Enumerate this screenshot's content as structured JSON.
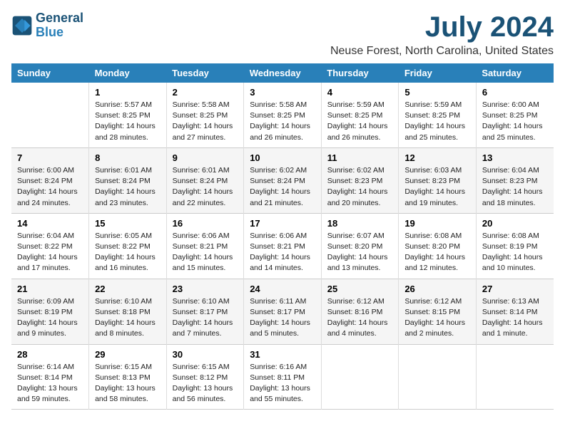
{
  "logo": {
    "line1": "General",
    "line2": "Blue"
  },
  "title": "July 2024",
  "subtitle": "Neuse Forest, North Carolina, United States",
  "days_of_week": [
    "Sunday",
    "Monday",
    "Tuesday",
    "Wednesday",
    "Thursday",
    "Friday",
    "Saturday"
  ],
  "weeks": [
    [
      {
        "day": "",
        "info": ""
      },
      {
        "day": "1",
        "info": "Sunrise: 5:57 AM\nSunset: 8:25 PM\nDaylight: 14 hours\nand 28 minutes."
      },
      {
        "day": "2",
        "info": "Sunrise: 5:58 AM\nSunset: 8:25 PM\nDaylight: 14 hours\nand 27 minutes."
      },
      {
        "day": "3",
        "info": "Sunrise: 5:58 AM\nSunset: 8:25 PM\nDaylight: 14 hours\nand 26 minutes."
      },
      {
        "day": "4",
        "info": "Sunrise: 5:59 AM\nSunset: 8:25 PM\nDaylight: 14 hours\nand 26 minutes."
      },
      {
        "day": "5",
        "info": "Sunrise: 5:59 AM\nSunset: 8:25 PM\nDaylight: 14 hours\nand 25 minutes."
      },
      {
        "day": "6",
        "info": "Sunrise: 6:00 AM\nSunset: 8:25 PM\nDaylight: 14 hours\nand 25 minutes."
      }
    ],
    [
      {
        "day": "7",
        "info": "Sunrise: 6:00 AM\nSunset: 8:24 PM\nDaylight: 14 hours\nand 24 minutes."
      },
      {
        "day": "8",
        "info": "Sunrise: 6:01 AM\nSunset: 8:24 PM\nDaylight: 14 hours\nand 23 minutes."
      },
      {
        "day": "9",
        "info": "Sunrise: 6:01 AM\nSunset: 8:24 PM\nDaylight: 14 hours\nand 22 minutes."
      },
      {
        "day": "10",
        "info": "Sunrise: 6:02 AM\nSunset: 8:24 PM\nDaylight: 14 hours\nand 21 minutes."
      },
      {
        "day": "11",
        "info": "Sunrise: 6:02 AM\nSunset: 8:23 PM\nDaylight: 14 hours\nand 20 minutes."
      },
      {
        "day": "12",
        "info": "Sunrise: 6:03 AM\nSunset: 8:23 PM\nDaylight: 14 hours\nand 19 minutes."
      },
      {
        "day": "13",
        "info": "Sunrise: 6:04 AM\nSunset: 8:23 PM\nDaylight: 14 hours\nand 18 minutes."
      }
    ],
    [
      {
        "day": "14",
        "info": "Sunrise: 6:04 AM\nSunset: 8:22 PM\nDaylight: 14 hours\nand 17 minutes."
      },
      {
        "day": "15",
        "info": "Sunrise: 6:05 AM\nSunset: 8:22 PM\nDaylight: 14 hours\nand 16 minutes."
      },
      {
        "day": "16",
        "info": "Sunrise: 6:06 AM\nSunset: 8:21 PM\nDaylight: 14 hours\nand 15 minutes."
      },
      {
        "day": "17",
        "info": "Sunrise: 6:06 AM\nSunset: 8:21 PM\nDaylight: 14 hours\nand 14 minutes."
      },
      {
        "day": "18",
        "info": "Sunrise: 6:07 AM\nSunset: 8:20 PM\nDaylight: 14 hours\nand 13 minutes."
      },
      {
        "day": "19",
        "info": "Sunrise: 6:08 AM\nSunset: 8:20 PM\nDaylight: 14 hours\nand 12 minutes."
      },
      {
        "day": "20",
        "info": "Sunrise: 6:08 AM\nSunset: 8:19 PM\nDaylight: 14 hours\nand 10 minutes."
      }
    ],
    [
      {
        "day": "21",
        "info": "Sunrise: 6:09 AM\nSunset: 8:19 PM\nDaylight: 14 hours\nand 9 minutes."
      },
      {
        "day": "22",
        "info": "Sunrise: 6:10 AM\nSunset: 8:18 PM\nDaylight: 14 hours\nand 8 minutes."
      },
      {
        "day": "23",
        "info": "Sunrise: 6:10 AM\nSunset: 8:17 PM\nDaylight: 14 hours\nand 7 minutes."
      },
      {
        "day": "24",
        "info": "Sunrise: 6:11 AM\nSunset: 8:17 PM\nDaylight: 14 hours\nand 5 minutes."
      },
      {
        "day": "25",
        "info": "Sunrise: 6:12 AM\nSunset: 8:16 PM\nDaylight: 14 hours\nand 4 minutes."
      },
      {
        "day": "26",
        "info": "Sunrise: 6:12 AM\nSunset: 8:15 PM\nDaylight: 14 hours\nand 2 minutes."
      },
      {
        "day": "27",
        "info": "Sunrise: 6:13 AM\nSunset: 8:14 PM\nDaylight: 14 hours\nand 1 minute."
      }
    ],
    [
      {
        "day": "28",
        "info": "Sunrise: 6:14 AM\nSunset: 8:14 PM\nDaylight: 13 hours\nand 59 minutes."
      },
      {
        "day": "29",
        "info": "Sunrise: 6:15 AM\nSunset: 8:13 PM\nDaylight: 13 hours\nand 58 minutes."
      },
      {
        "day": "30",
        "info": "Sunrise: 6:15 AM\nSunset: 8:12 PM\nDaylight: 13 hours\nand 56 minutes."
      },
      {
        "day": "31",
        "info": "Sunrise: 6:16 AM\nSunset: 8:11 PM\nDaylight: 13 hours\nand 55 minutes."
      },
      {
        "day": "",
        "info": ""
      },
      {
        "day": "",
        "info": ""
      },
      {
        "day": "",
        "info": ""
      }
    ]
  ]
}
